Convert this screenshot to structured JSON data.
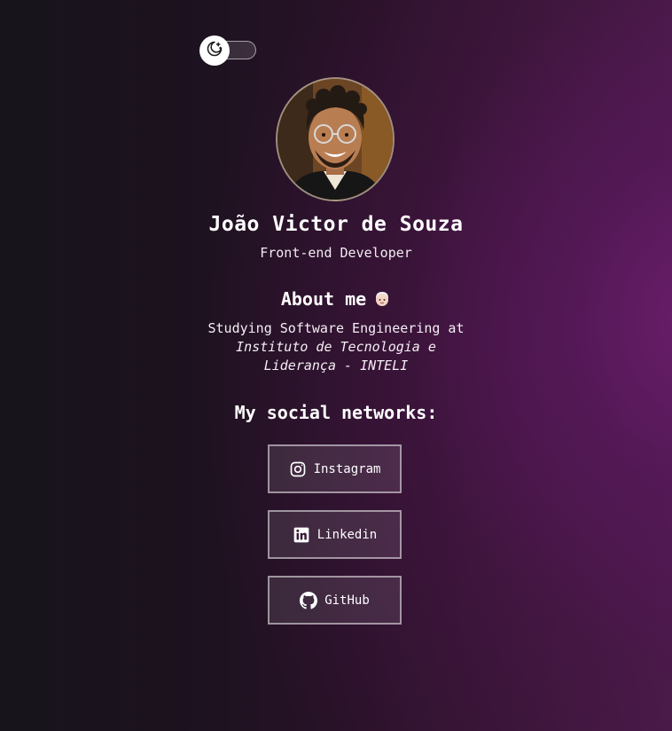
{
  "theme_toggle": {
    "icon": "moon-stars-icon",
    "state": "off"
  },
  "profile": {
    "name": "João Victor de Souza",
    "role": "Front-end Developer",
    "avatar_icon": "profile-photo"
  },
  "about": {
    "title": "About me",
    "emoji_icon": "person-emoji-icon",
    "text_line": "Studying Software Engineering at",
    "institution_line1": "Instituto de Tecnologia e",
    "institution_line2": "Liderança - INTELI"
  },
  "social": {
    "title": "My social networks:",
    "links": [
      {
        "label": "Instagram",
        "icon": "instagram-icon"
      },
      {
        "label": "Linkedin",
        "icon": "linkedin-icon"
      },
      {
        "label": "GitHub",
        "icon": "github-icon"
      }
    ]
  },
  "colors": {
    "background_dark": "#17141c",
    "background_accent": "#6e1e6e",
    "text": "#ffffff"
  }
}
